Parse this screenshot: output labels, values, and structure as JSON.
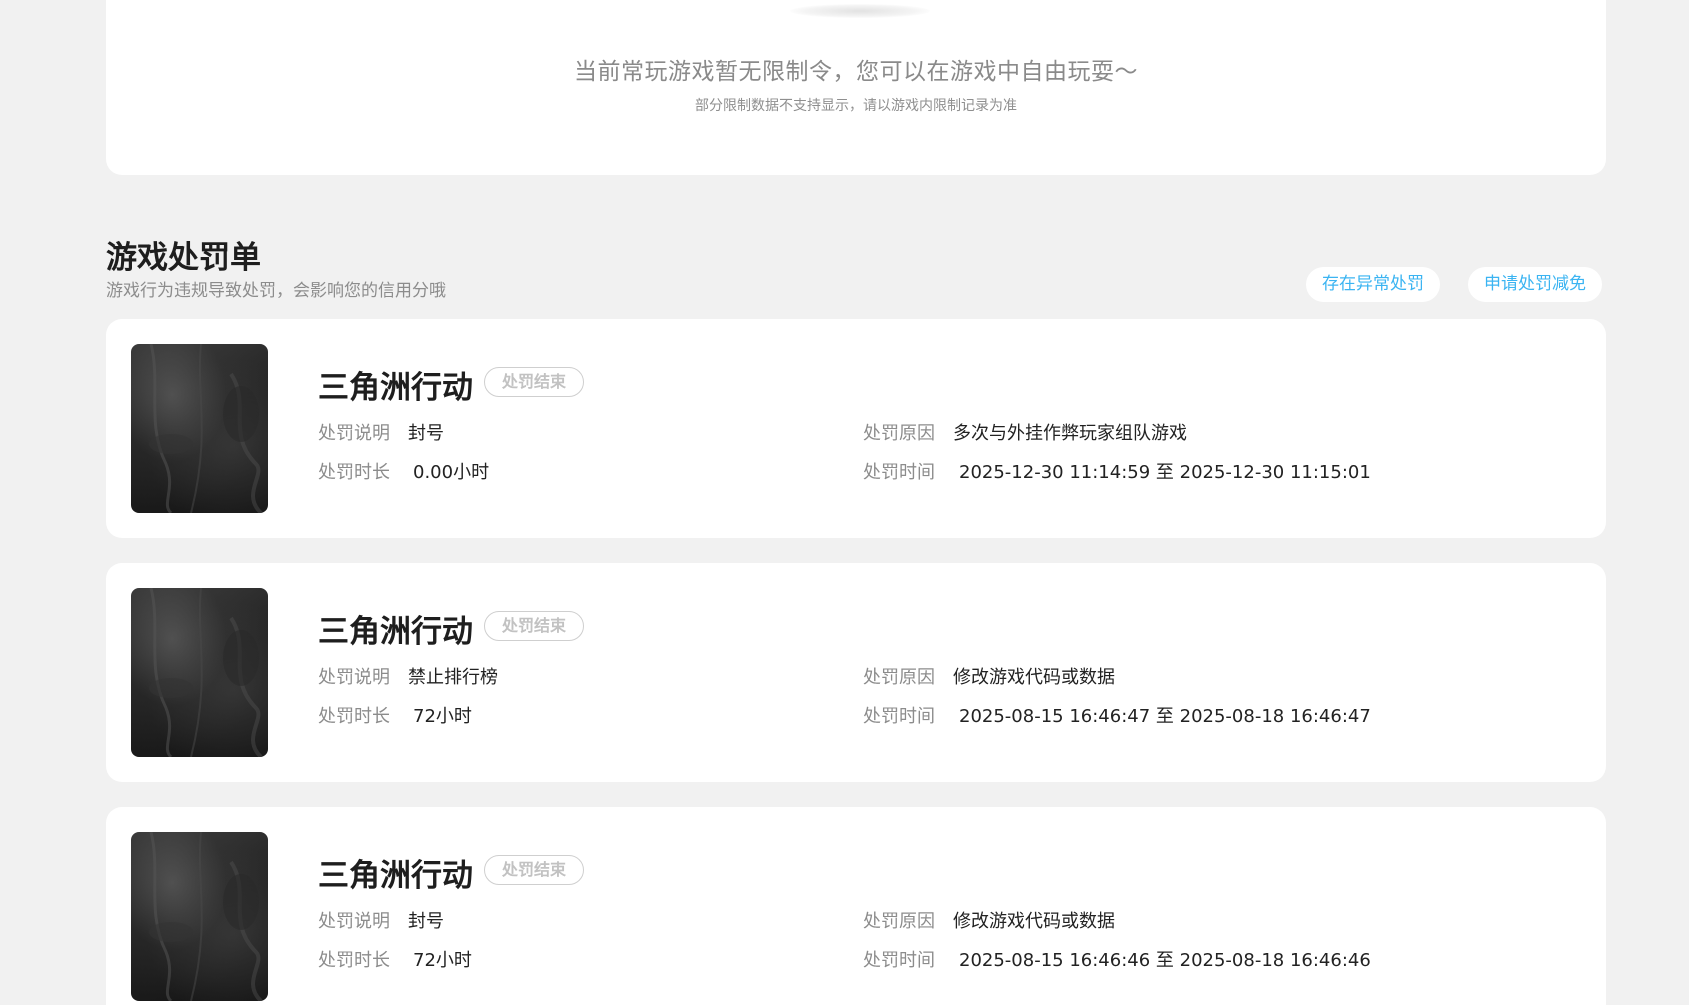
{
  "notice": {
    "title": "当前常玩游戏暂无限制令，您可以在游戏中自由玩耍～",
    "subtitle": "部分限制数据不支持显示，请以游戏内限制记录为准"
  },
  "section": {
    "title": "游戏处罚单",
    "subtitle": "游戏行为违规导致处罚，会影响您的信用分哦",
    "btn_abnormal": "存在异常处罚",
    "btn_reduce": "申请处罚减免"
  },
  "labels": {
    "desc": "处罚说明",
    "duration": "处罚时长",
    "reason": "处罚原因",
    "time": "处罚时间"
  },
  "penalties": [
    {
      "game": "三角洲行动",
      "status": "处罚结束",
      "desc": "封号",
      "duration": "0.00小时",
      "reason": "多次与外挂作弊玩家组队游戏",
      "time": "2025-12-30 11:14:59 至 2025-12-30 11:15:01"
    },
    {
      "game": "三角洲行动",
      "status": "处罚结束",
      "desc": "禁止排行榜",
      "duration": "72小时",
      "reason": "修改游戏代码或数据",
      "time": "2025-08-15 16:46:47 至 2025-08-18 16:46:47"
    },
    {
      "game": "三角洲行动",
      "status": "处罚结束",
      "desc": "封号",
      "duration": "72小时",
      "reason": "修改游戏代码或数据",
      "time": "2025-08-15 16:46:46 至 2025-08-18 16:46:46"
    }
  ]
}
